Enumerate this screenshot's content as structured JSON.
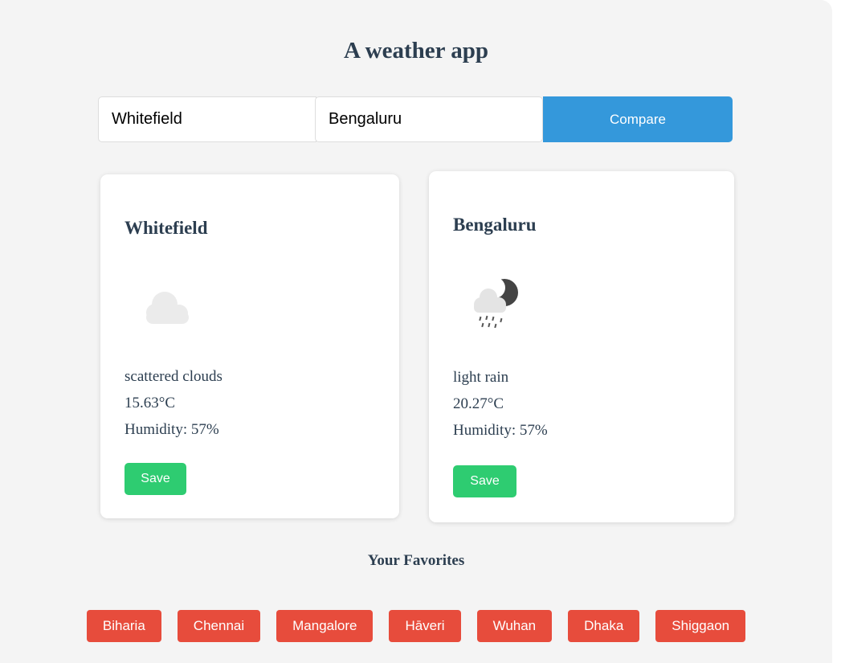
{
  "app": {
    "title": "A weather app"
  },
  "search": {
    "city1_value": "Whitefield",
    "city2_value": "Bengaluru",
    "compare_label": "Compare"
  },
  "cards": [
    {
      "city": "Whitefield",
      "icon": "scattered-clouds-icon",
      "description": "scattered clouds",
      "temperature": "15.63°C",
      "humidity": "Humidity: 57%",
      "save_label": "Save"
    },
    {
      "city": "Bengaluru",
      "icon": "night-light-rain-icon",
      "description": "light rain",
      "temperature": "20.27°C",
      "humidity": "Humidity: 57%",
      "save_label": "Save"
    }
  ],
  "favorites": {
    "title": "Your Favorites",
    "items": [
      "Biharia",
      "Chennai",
      "Mangalore",
      "Hāveri",
      "Wuhan",
      "Dhaka",
      "Shiggaon"
    ]
  },
  "colors": {
    "compare": "#3498db",
    "save": "#2ecc71",
    "favorite": "#e74c3c",
    "text": "#2c3e50",
    "background": "#f4f4f4"
  }
}
